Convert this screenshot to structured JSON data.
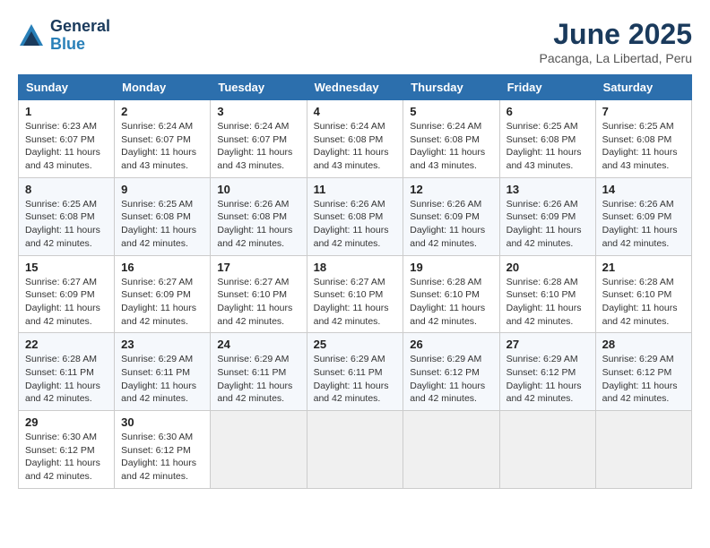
{
  "header": {
    "logo_line1": "General",
    "logo_line2": "Blue",
    "month": "June 2025",
    "location": "Pacanga, La Libertad, Peru"
  },
  "weekdays": [
    "Sunday",
    "Monday",
    "Tuesday",
    "Wednesday",
    "Thursday",
    "Friday",
    "Saturday"
  ],
  "weeks": [
    [
      {
        "day": "1",
        "sunrise": "6:23 AM",
        "sunset": "6:07 PM",
        "daylight": "11 hours and 43 minutes."
      },
      {
        "day": "2",
        "sunrise": "6:24 AM",
        "sunset": "6:07 PM",
        "daylight": "11 hours and 43 minutes."
      },
      {
        "day": "3",
        "sunrise": "6:24 AM",
        "sunset": "6:07 PM",
        "daylight": "11 hours and 43 minutes."
      },
      {
        "day": "4",
        "sunrise": "6:24 AM",
        "sunset": "6:08 PM",
        "daylight": "11 hours and 43 minutes."
      },
      {
        "day": "5",
        "sunrise": "6:24 AM",
        "sunset": "6:08 PM",
        "daylight": "11 hours and 43 minutes."
      },
      {
        "day": "6",
        "sunrise": "6:25 AM",
        "sunset": "6:08 PM",
        "daylight": "11 hours and 43 minutes."
      },
      {
        "day": "7",
        "sunrise": "6:25 AM",
        "sunset": "6:08 PM",
        "daylight": "11 hours and 43 minutes."
      }
    ],
    [
      {
        "day": "8",
        "sunrise": "6:25 AM",
        "sunset": "6:08 PM",
        "daylight": "11 hours and 42 minutes."
      },
      {
        "day": "9",
        "sunrise": "6:25 AM",
        "sunset": "6:08 PM",
        "daylight": "11 hours and 42 minutes."
      },
      {
        "day": "10",
        "sunrise": "6:26 AM",
        "sunset": "6:08 PM",
        "daylight": "11 hours and 42 minutes."
      },
      {
        "day": "11",
        "sunrise": "6:26 AM",
        "sunset": "6:08 PM",
        "daylight": "11 hours and 42 minutes."
      },
      {
        "day": "12",
        "sunrise": "6:26 AM",
        "sunset": "6:09 PM",
        "daylight": "11 hours and 42 minutes."
      },
      {
        "day": "13",
        "sunrise": "6:26 AM",
        "sunset": "6:09 PM",
        "daylight": "11 hours and 42 minutes."
      },
      {
        "day": "14",
        "sunrise": "6:26 AM",
        "sunset": "6:09 PM",
        "daylight": "11 hours and 42 minutes."
      }
    ],
    [
      {
        "day": "15",
        "sunrise": "6:27 AM",
        "sunset": "6:09 PM",
        "daylight": "11 hours and 42 minutes."
      },
      {
        "day": "16",
        "sunrise": "6:27 AM",
        "sunset": "6:09 PM",
        "daylight": "11 hours and 42 minutes."
      },
      {
        "day": "17",
        "sunrise": "6:27 AM",
        "sunset": "6:10 PM",
        "daylight": "11 hours and 42 minutes."
      },
      {
        "day": "18",
        "sunrise": "6:27 AM",
        "sunset": "6:10 PM",
        "daylight": "11 hours and 42 minutes."
      },
      {
        "day": "19",
        "sunrise": "6:28 AM",
        "sunset": "6:10 PM",
        "daylight": "11 hours and 42 minutes."
      },
      {
        "day": "20",
        "sunrise": "6:28 AM",
        "sunset": "6:10 PM",
        "daylight": "11 hours and 42 minutes."
      },
      {
        "day": "21",
        "sunrise": "6:28 AM",
        "sunset": "6:10 PM",
        "daylight": "11 hours and 42 minutes."
      }
    ],
    [
      {
        "day": "22",
        "sunrise": "6:28 AM",
        "sunset": "6:11 PM",
        "daylight": "11 hours and 42 minutes."
      },
      {
        "day": "23",
        "sunrise": "6:29 AM",
        "sunset": "6:11 PM",
        "daylight": "11 hours and 42 minutes."
      },
      {
        "day": "24",
        "sunrise": "6:29 AM",
        "sunset": "6:11 PM",
        "daylight": "11 hours and 42 minutes."
      },
      {
        "day": "25",
        "sunrise": "6:29 AM",
        "sunset": "6:11 PM",
        "daylight": "11 hours and 42 minutes."
      },
      {
        "day": "26",
        "sunrise": "6:29 AM",
        "sunset": "6:12 PM",
        "daylight": "11 hours and 42 minutes."
      },
      {
        "day": "27",
        "sunrise": "6:29 AM",
        "sunset": "6:12 PM",
        "daylight": "11 hours and 42 minutes."
      },
      {
        "day": "28",
        "sunrise": "6:29 AM",
        "sunset": "6:12 PM",
        "daylight": "11 hours and 42 minutes."
      }
    ],
    [
      {
        "day": "29",
        "sunrise": "6:30 AM",
        "sunset": "6:12 PM",
        "daylight": "11 hours and 42 minutes."
      },
      {
        "day": "30",
        "sunrise": "6:30 AM",
        "sunset": "6:12 PM",
        "daylight": "11 hours and 42 minutes."
      },
      null,
      null,
      null,
      null,
      null
    ]
  ]
}
